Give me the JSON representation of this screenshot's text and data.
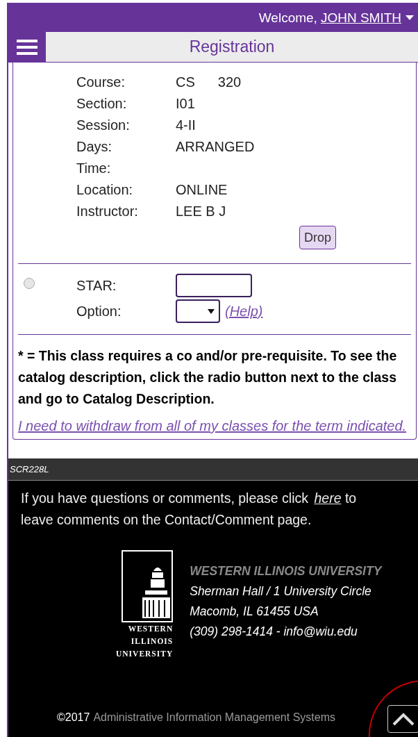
{
  "header": {
    "welcome": "Welcome,",
    "user": "JOHN SMITH",
    "title": "Registration"
  },
  "course_fields": [
    {
      "label": "Course:",
      "values": [
        "CS",
        "320"
      ]
    },
    {
      "label": "Section:",
      "values": [
        "I01"
      ]
    },
    {
      "label": "Session:",
      "values": [
        "4-II"
      ]
    },
    {
      "label": "Days:",
      "values": [
        "ARRANGED"
      ]
    },
    {
      "label": "Time:"
    },
    {
      "label": "Location:",
      "values": [
        "ONLINE"
      ]
    },
    {
      "label": "Instructor:",
      "values": [
        "LEE B J"
      ]
    }
  ],
  "drop_button": "Drop",
  "star_row": {
    "selected": false,
    "star_label": "STAR:",
    "option_label": "Option:",
    "help": "(Help)"
  },
  "note": "* = This class requires a co and/or pre-requisite. To see the catalog description, click the radio button next to the class and go to Catalog Description.",
  "withdraw_link": "I need to withdraw from all of my classes for the term indicated.",
  "screen_id": "SCR228L",
  "footer": {
    "comment_before": "If you have questions or comments, please click",
    "comment_link": "here",
    "comment_after": "to leave comments on the Contact/Comment page.",
    "logo_text": [
      "WESTERN",
      "ILLINOIS",
      "UNIVERSITY"
    ],
    "university": "WESTERN ILLINOIS UNIVERSITY",
    "address": [
      "Sherman Hall / 1 University Circle",
      "Macomb, IL 61455 USA",
      "(309) 298-1414 - info@wiu.edu"
    ],
    "copyright": "©2017",
    "system": "Administrative Information Management Systems"
  }
}
